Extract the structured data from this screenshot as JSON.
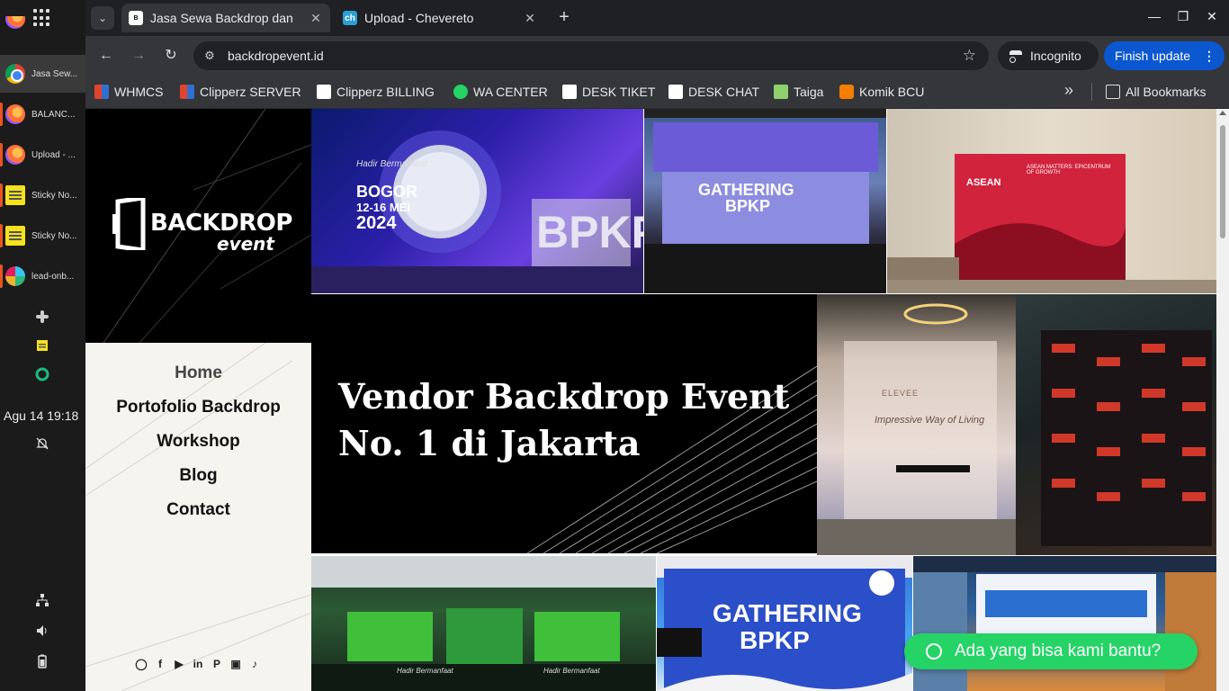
{
  "dock": {
    "items": [
      {
        "label": "Jasa Sew...",
        "icon": "chrome-icon"
      },
      {
        "label": "BALANC...",
        "icon": "firefox-icon"
      },
      {
        "label": "Upload - ...",
        "icon": "firefox-icon"
      },
      {
        "label": "Sticky No...",
        "icon": "sticky-notes-icon"
      },
      {
        "label": "Sticky No...",
        "icon": "sticky-notes-icon"
      },
      {
        "label": "lead-onb...",
        "icon": "slack-icon"
      }
    ],
    "clock": "Agu 14  19:18"
  },
  "tabs": [
    {
      "title": "Jasa Sewa Backdrop dan",
      "active": true
    },
    {
      "title": "Upload - Chevereto",
      "favicon_text": "ch",
      "active": false
    }
  ],
  "toolbar": {
    "url": "backdropevent.id",
    "incognito": "Incognito",
    "finish_update": "Finish update"
  },
  "bookmarks": [
    {
      "label": "WHMCS",
      "color": "#e0442d"
    },
    {
      "label": "Clipperz SERVER",
      "color": "#e0442d"
    },
    {
      "label": "Clipperz BILLING",
      "color": "#ffffff"
    },
    {
      "label": "WA CENTER",
      "color": "#25d366"
    },
    {
      "label": "DESK TIKET",
      "color": "#ffffff"
    },
    {
      "label": "DESK CHAT",
      "color": "#ffffff"
    },
    {
      "label": "Taiga",
      "color": "#8ed16c"
    },
    {
      "label": "Komik BCU",
      "color": "#f57d00"
    }
  ],
  "all_bookmarks": "All Bookmarks",
  "site": {
    "logo_line1": "BACKDROP",
    "logo_line2": "event",
    "nav": [
      "Home",
      "Portofolio Backdrop",
      "Workshop",
      "Blog",
      "Contact"
    ],
    "hero_title_line1": "Vendor Backdrop Event",
    "hero_title_line2": "No. 1 di Jakarta",
    "whatsapp_cta": "Ada yang bisa kami bantu?",
    "social": [
      "whatsapp-icon",
      "facebook-icon",
      "youtube-icon",
      "linkedin-icon",
      "pinterest-icon",
      "instagram-icon",
      "tiktok-icon"
    ]
  },
  "photos": {
    "p1": {
      "caption1": "Hadir Bermanfaat",
      "caption2": "BOGOR",
      "caption3": "12-16 MEI",
      "caption4": "2024",
      "caption5": "BPKP"
    },
    "p2": {
      "caption1": "GATHERING",
      "caption2": "BPKP"
    },
    "p3": {
      "caption1": "ASEAN",
      "caption2": "ASEAN MATTERS: EPICENTRUM OF GROWTH"
    },
    "p4": {
      "caption1": "ELEVEE",
      "caption2": "Impressive Way of Living"
    },
    "p6": {
      "caption1": "Hadir Bermanfaat",
      "caption2": "Hadir Bermanfaat"
    },
    "p7": {
      "caption1": "GATHERING",
      "caption2": "BPKP"
    }
  }
}
